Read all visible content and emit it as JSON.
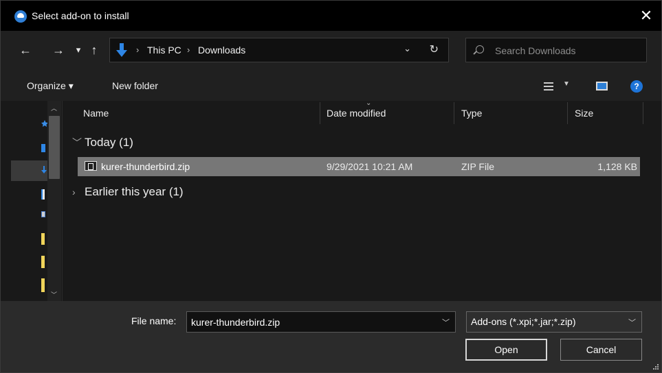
{
  "dialog": {
    "title": "Select add-on to install",
    "close_label": "✕"
  },
  "navigation": {
    "back": "←",
    "forward": "→",
    "recent": "▾",
    "up": "↑",
    "breadcrumbs": [
      "This PC",
      "Downloads"
    ],
    "breadcrumb_separator": "›",
    "address_dropdown": "⌄",
    "refresh": "↻",
    "search_placeholder": "Search Downloads"
  },
  "commandbar": {
    "organize_label": "Organize ▾",
    "new_folder_label": "New folder",
    "view_dropdown": "▼",
    "help": "?"
  },
  "file_list": {
    "columns": [
      "Name",
      "Date modified",
      "Type",
      "Size"
    ],
    "groups": [
      {
        "label": "Today (1)",
        "expanded": true,
        "items": [
          {
            "name": "kurer-thunderbird.zip",
            "date_modified": "9/29/2021 10:21 AM",
            "type": "ZIP File",
            "size": "1,128 KB"
          }
        ]
      },
      {
        "label": "Earlier this year (1)",
        "expanded": false,
        "items": []
      }
    ]
  },
  "footer": {
    "file_name_label": "File name:",
    "file_name_value": "kurer-thunderbird.zip",
    "file_type": "Add-ons (*.xpi;*.jar;*.zip)",
    "open_label": "Open",
    "cancel_label": "Cancel"
  },
  "colors": {
    "accent": "#1e74d8",
    "selection": "#777777",
    "background": "#191919"
  }
}
